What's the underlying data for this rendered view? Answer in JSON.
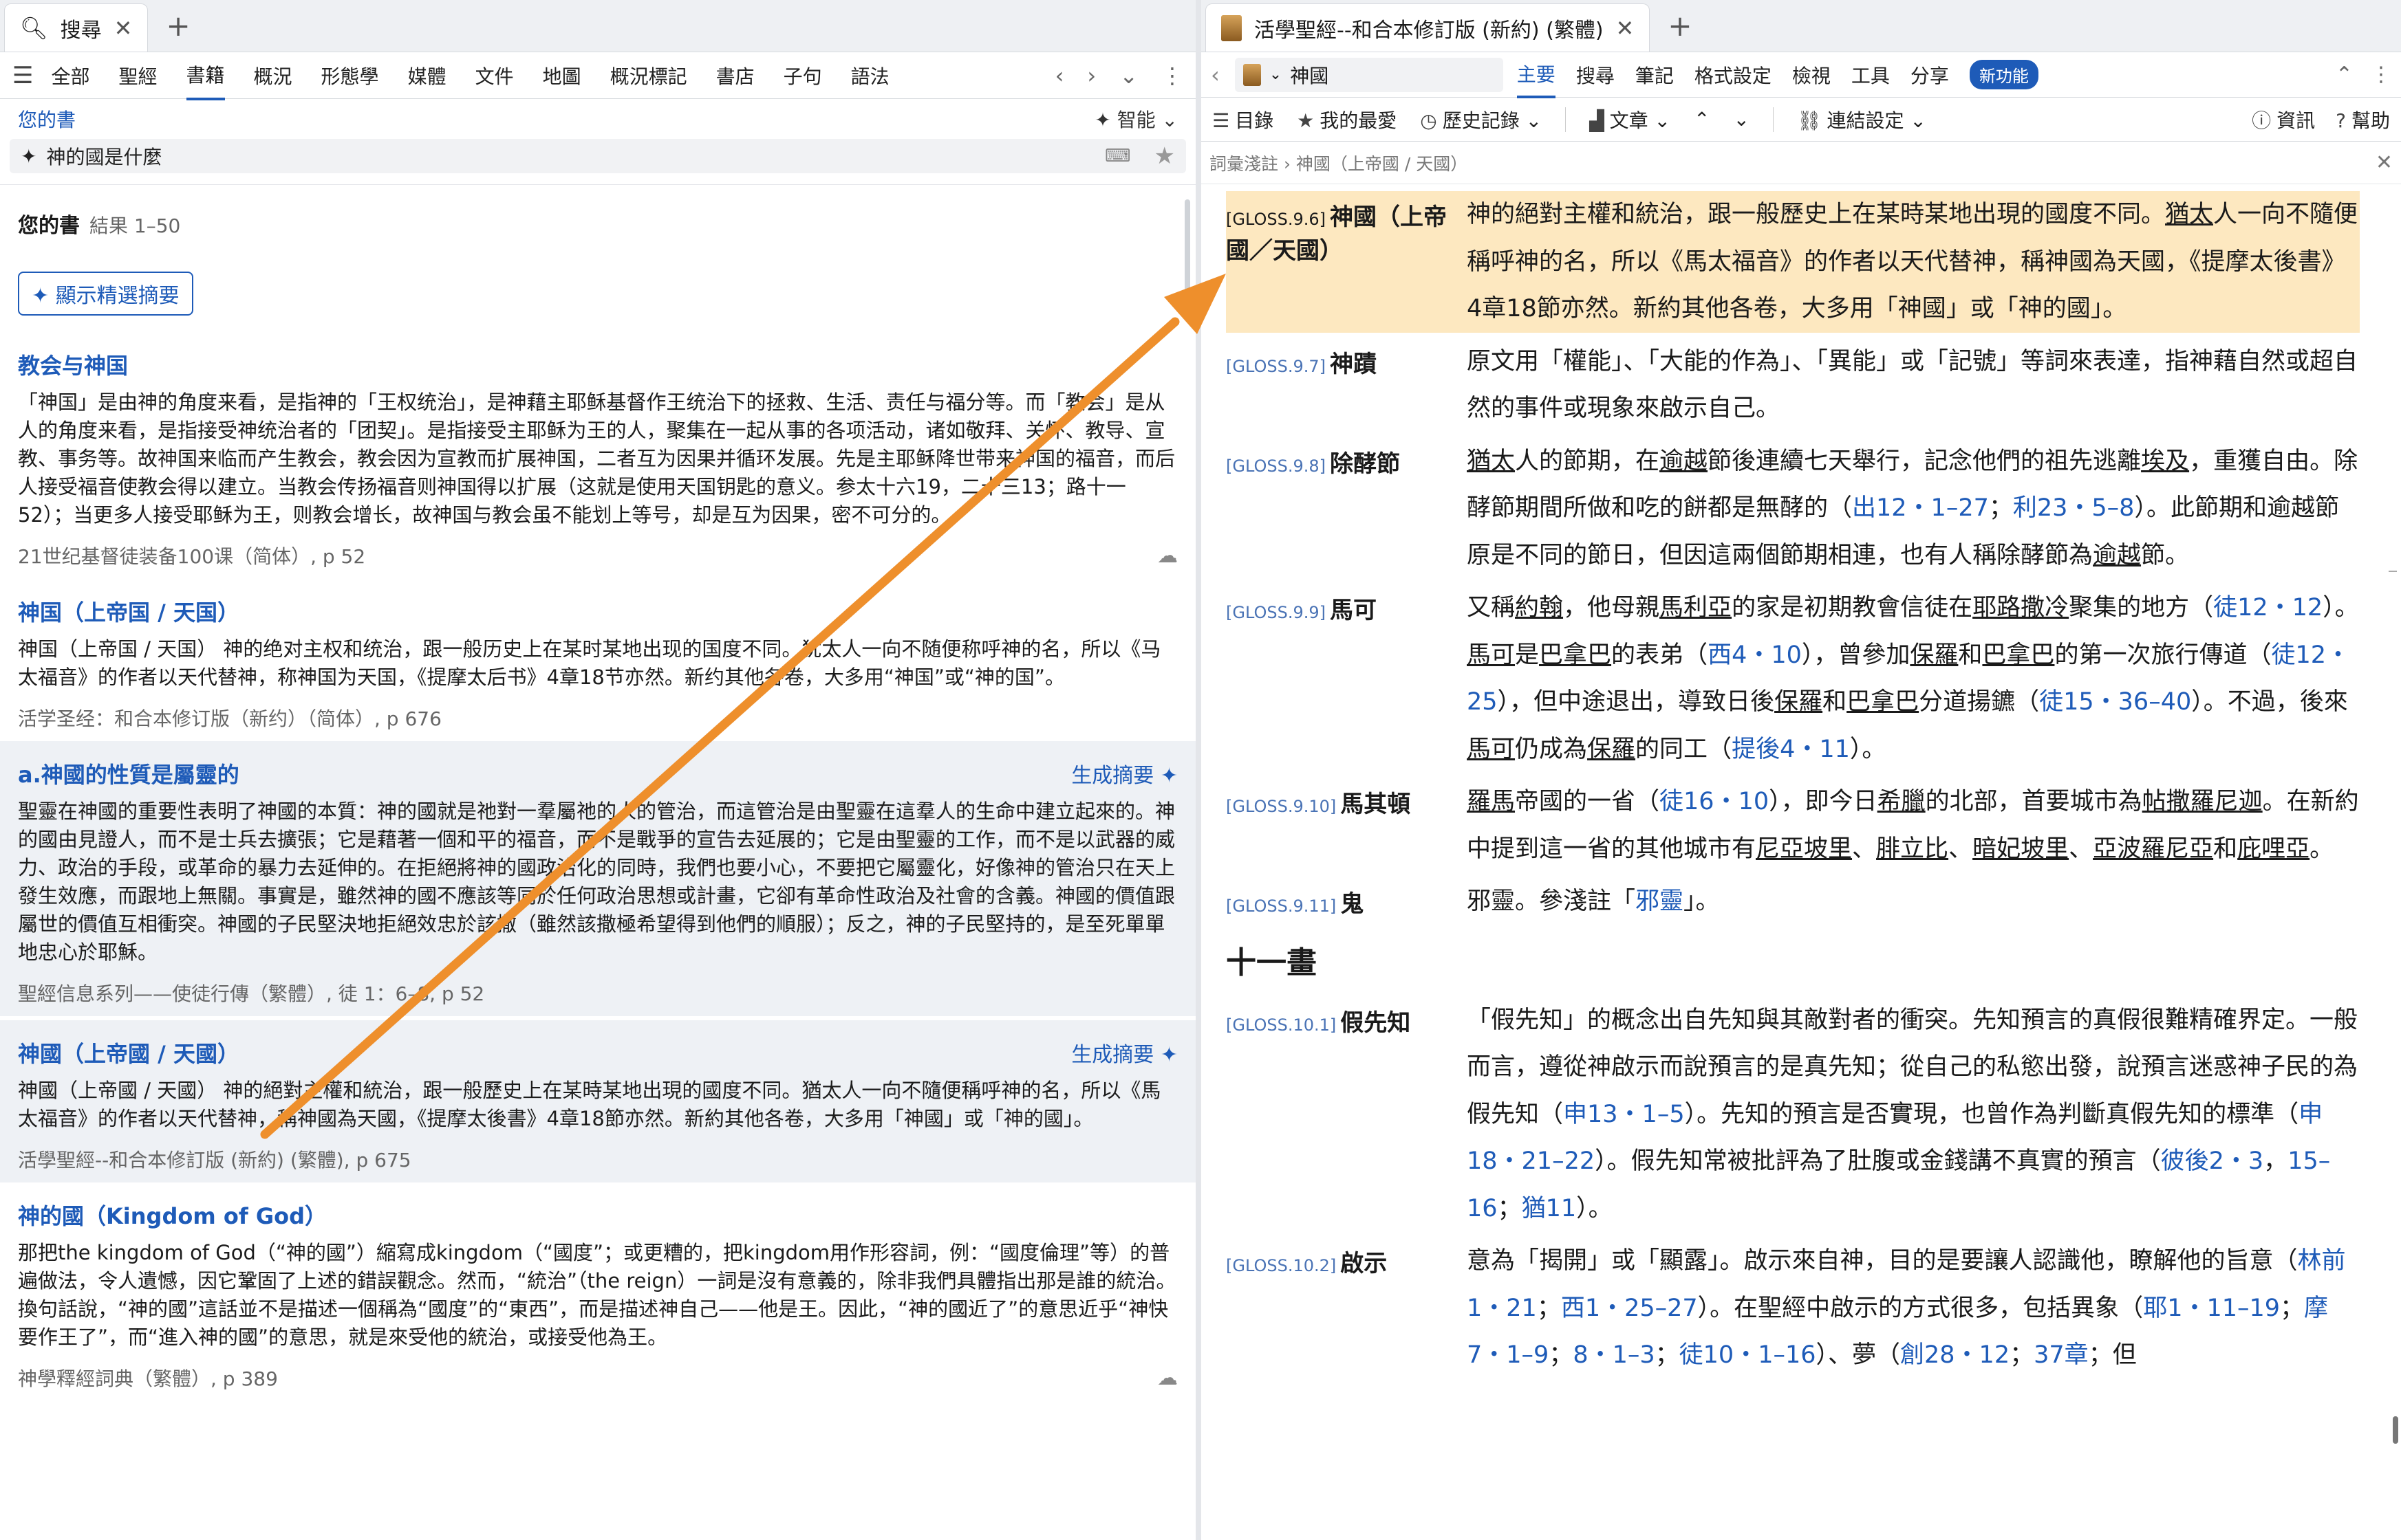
{
  "left": {
    "tab": {
      "icon": "search-icon",
      "label": "搜尋"
    },
    "nav": [
      "全部",
      "聖經",
      "書籍",
      "概況",
      "形態學",
      "媒體",
      "文件",
      "地圖",
      "概況標記",
      "書店",
      "子句",
      "語法"
    ],
    "nav_active_index": 2,
    "your_books": "您的書",
    "smart": "智能",
    "query": "神的國是什麼",
    "results_title": "您的書",
    "results_range": "結果 1–50",
    "show_summary": "顯示精選摘要",
    "generate_summary": "生成摘要",
    "results": [
      {
        "title": "教会与神国",
        "body": "「神国」是由神的角度来看，是指神的「王权统治」，是神藉主耶稣基督作王统治下的拯救、生活、责任与福分等。而「教会」是从人的角度来看，是指接受神统治者的「团契」。是指接受主耶稣为王的人，聚集在一起从事的各项活动，诸如敬拜、关怀、教导、宣教、事务等。故神国来临而产生教会，教会因为宣教而扩展神国，二者互为因果并循环发展。先是主耶稣降世带来神国的福音，而后人接受福音使教会得以建立。当教会传扬福音则神国得以扩展（这就是使用天国钥匙的意义。参太十六19，二十三13；路十一52）；当更多人接受耶稣为王，则教会增长，故神国与教会虽不能划上等号，却是互为因果，密不可分的。",
        "source": "21世纪基督徒装备100课（简体）, p 52"
      },
      {
        "title": "神国（上帝国 / 天国）",
        "body": "神国（上帝国 / 天国） 神的绝对主权和统治，跟一般历史上在某时某地出现的国度不同。犹太人一向不随便称呼神的名，所以《马太福音》的作者以天代替神，称神国为天国，《提摩太后书》4章18节亦然。新约其他各卷，大多用“神国”或“神的国”。",
        "source": "活学圣经：和合本修订版（新约）（简体）, p 676"
      },
      {
        "title": "a.神國的性質是屬靈的",
        "body": "聖靈在神國的重要性表明了神國的本質：神的國就是祂對一羣屬祂的人的管治，而這管治是由聖靈在這羣人的生命中建立起來的。神的國由見證人，而不是士兵去擴張；它是藉著一個和平的福音，而不是戰爭的宣告去延展的；它是由聖靈的工作，而不是以武器的威力、政治的手段，或革命的暴力去延伸的。在拒絕將神的國政治化的同時，我們也要小心，不要把它屬靈化，好像神的管治只在天上發生效應，而跟地上無關。事實是，雖然神的國不應該等同於任何政治思想或計畫，它卻有革命性政治及社會的含義。神國的價值跟屬世的價值互相衝突。神國的子民堅決地拒絕效忠於該撒（雖然該撒極希望得到他們的順服）；反之，神的子民堅持的，是至死單單地忠心於耶穌。",
        "source": "聖經信息系列——使徒行傳（繁體）, 徒 1：6–8, p 52"
      },
      {
        "title": "神國（上帝國 / 天國）",
        "body": "神國（上帝國 / 天國） 神的絕對主權和統治，跟一般歷史上在某時某地出現的國度不同。猶太人一向不隨便稱呼神的名，所以《馬太福音》的作者以天代替神，稱神國為天國，《提摩太後書》4章18節亦然。新約其他各卷，大多用「神國」或「神的國」。",
        "source": "活學聖經--和合本修訂版 (新約) (繁體), p 675"
      },
      {
        "title": "神的國（Kingdom of God）",
        "body": "那把the kingdom of God（“神的國”）縮寫成kingdom（“國度”；或更糟的，把kingdom用作形容詞，例：“國度倫理”等）的普遍做法，令人遺憾，因它鞏固了上述的錯誤觀念。然而，“統治”（the reign）一詞是沒有意義的，除非我們具體指出那是誰的統治。換句話說，“神的國”這話並不是描述一個稱為“國度”的“東西”，而是描述神自己——他是王。因此，“神的國近了”的意思近乎“神快要作王了”，而“進入神的國”的意思，就是來受他的統治，或接受他為王。",
        "source": "神學釋經詞典（繁體）, p 389"
      }
    ]
  },
  "right": {
    "tab": "活學聖經--和合本修訂版 (新約) (繁體)",
    "reference": "神國",
    "tabs": [
      "主要",
      "搜尋",
      "筆記",
      "格式設定",
      "檢視",
      "工具",
      "分享"
    ],
    "tab_active_index": 0,
    "new_feature": "新功能",
    "toolbar": {
      "contents": "目錄",
      "favorites": "我的最愛",
      "history": "歷史記錄",
      "text": "文章",
      "link": "連結設定",
      "info": "資訊",
      "help": "幫助"
    },
    "breadcrumb": "詞彙淺註 › 神國（上帝國 / 天國）",
    "section_title": "十一畫"
  },
  "colors": {
    "accent": "#1e5bb8",
    "highlight": "#fde8c0",
    "arrow": "#ee8f2c"
  }
}
